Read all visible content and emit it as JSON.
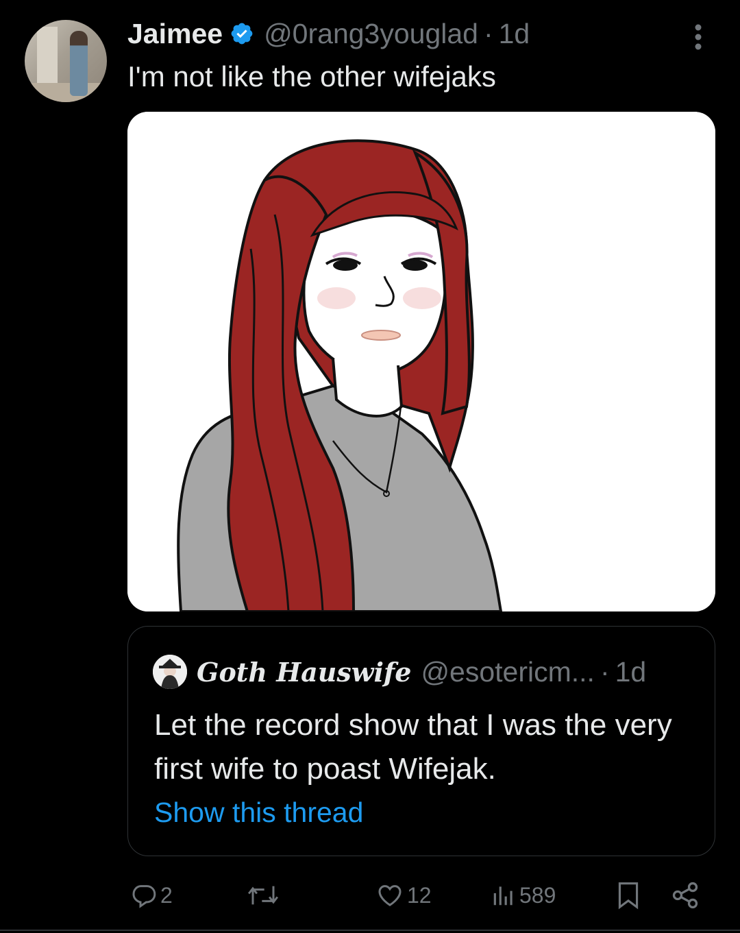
{
  "post": {
    "author_name": "Jaimee",
    "handle": "@0rang3youglad",
    "separator": "·",
    "time": "1d",
    "text": "I'm not like the other wifejaks",
    "verified": true
  },
  "media": {
    "hair_color": "#9b2523",
    "shirt_color": "#a6a6a6",
    "background_color": "#ffffff"
  },
  "quoted_post": {
    "author_name": "Goth Hauswife",
    "handle": "@esotericm...",
    "separator": "·",
    "time": "1d",
    "text": "Let the record show that I was the very first wife to poast Wifejak.",
    "link": "Show this thread"
  },
  "actions": {
    "reply_count": "2",
    "like_count": "12",
    "view_count": "589"
  },
  "colors": {
    "background": "#000000",
    "text_primary": "#e7e9ea",
    "text_secondary": "#71767b",
    "accent": "#1d9bf0",
    "border": "#2f3336"
  }
}
